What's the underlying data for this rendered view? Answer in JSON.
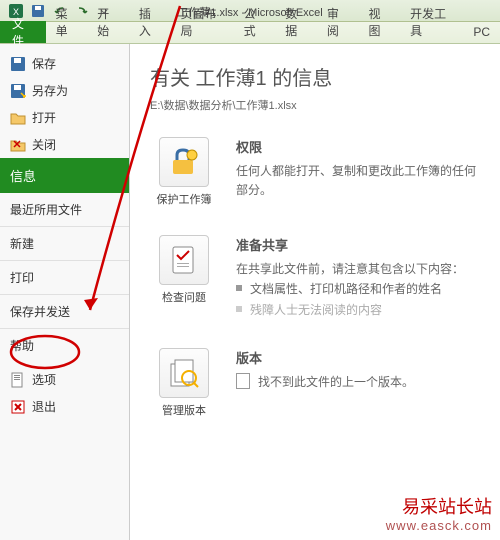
{
  "window": {
    "title": "工作薄1.xlsx - Microsoft Excel"
  },
  "ribbon": {
    "file": "文件",
    "tabs": [
      "菜单",
      "开始",
      "插入",
      "页面布局",
      "公式",
      "数据",
      "审阅",
      "视图",
      "开发工具",
      "PC"
    ]
  },
  "backstage": {
    "top": [
      {
        "label": "保存",
        "icon": "save"
      },
      {
        "label": "另存为",
        "icon": "save-as"
      },
      {
        "label": "打开",
        "icon": "open"
      },
      {
        "label": "关闭",
        "icon": "close"
      }
    ],
    "selected": "信息",
    "sections": [
      "最近所用文件",
      "新建",
      "打印",
      "保存并发送",
      "帮助"
    ],
    "bottom": [
      {
        "label": "选项",
        "icon": "options"
      },
      {
        "label": "退出",
        "icon": "exit"
      }
    ]
  },
  "info": {
    "title": "有关 工作薄1 的信息",
    "path": "E:\\数据\\数据分析\\工作薄1.xlsx",
    "blocks": {
      "protect": {
        "caption": "保护工作簿",
        "title": "权限",
        "text": "任何人都能打开、复制和更改此工作簿的任何部分。"
      },
      "check": {
        "caption": "检查问题",
        "title": "准备共享",
        "text": "在共享此文件前，请注意其包含以下内容：",
        "bullets": [
          "文档属性、打印机路径和作者的姓名",
          "残障人士无法阅读的内容"
        ]
      },
      "versions": {
        "caption": "管理版本",
        "title": "版本",
        "text": "找不到此文件的上一个版本。"
      }
    }
  },
  "watermark": {
    "text": "易采站长站",
    "url": "www.easck.com"
  }
}
